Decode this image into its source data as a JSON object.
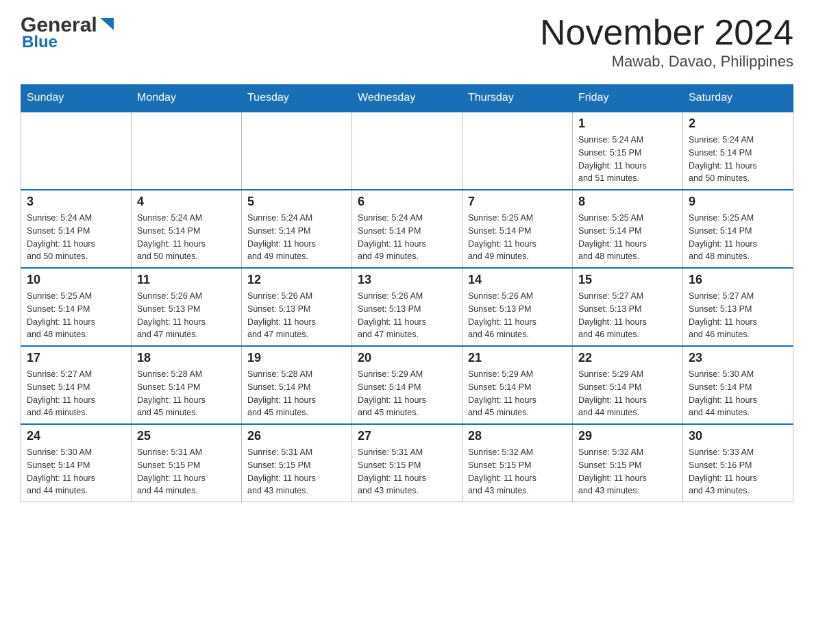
{
  "header": {
    "logo_general": "General",
    "logo_blue": "Blue",
    "month_title": "November 2024",
    "location": "Mawab, Davao, Philippines"
  },
  "days_of_week": [
    "Sunday",
    "Monday",
    "Tuesday",
    "Wednesday",
    "Thursday",
    "Friday",
    "Saturday"
  ],
  "weeks": [
    {
      "days": [
        {
          "number": "",
          "info": ""
        },
        {
          "number": "",
          "info": ""
        },
        {
          "number": "",
          "info": ""
        },
        {
          "number": "",
          "info": ""
        },
        {
          "number": "",
          "info": ""
        },
        {
          "number": "1",
          "info": "Sunrise: 5:24 AM\nSunset: 5:15 PM\nDaylight: 11 hours\nand 51 minutes."
        },
        {
          "number": "2",
          "info": "Sunrise: 5:24 AM\nSunset: 5:14 PM\nDaylight: 11 hours\nand 50 minutes."
        }
      ]
    },
    {
      "days": [
        {
          "number": "3",
          "info": "Sunrise: 5:24 AM\nSunset: 5:14 PM\nDaylight: 11 hours\nand 50 minutes."
        },
        {
          "number": "4",
          "info": "Sunrise: 5:24 AM\nSunset: 5:14 PM\nDaylight: 11 hours\nand 50 minutes."
        },
        {
          "number": "5",
          "info": "Sunrise: 5:24 AM\nSunset: 5:14 PM\nDaylight: 11 hours\nand 49 minutes."
        },
        {
          "number": "6",
          "info": "Sunrise: 5:24 AM\nSunset: 5:14 PM\nDaylight: 11 hours\nand 49 minutes."
        },
        {
          "number": "7",
          "info": "Sunrise: 5:25 AM\nSunset: 5:14 PM\nDaylight: 11 hours\nand 49 minutes."
        },
        {
          "number": "8",
          "info": "Sunrise: 5:25 AM\nSunset: 5:14 PM\nDaylight: 11 hours\nand 48 minutes."
        },
        {
          "number": "9",
          "info": "Sunrise: 5:25 AM\nSunset: 5:14 PM\nDaylight: 11 hours\nand 48 minutes."
        }
      ]
    },
    {
      "days": [
        {
          "number": "10",
          "info": "Sunrise: 5:25 AM\nSunset: 5:14 PM\nDaylight: 11 hours\nand 48 minutes."
        },
        {
          "number": "11",
          "info": "Sunrise: 5:26 AM\nSunset: 5:13 PM\nDaylight: 11 hours\nand 47 minutes."
        },
        {
          "number": "12",
          "info": "Sunrise: 5:26 AM\nSunset: 5:13 PM\nDaylight: 11 hours\nand 47 minutes."
        },
        {
          "number": "13",
          "info": "Sunrise: 5:26 AM\nSunset: 5:13 PM\nDaylight: 11 hours\nand 47 minutes."
        },
        {
          "number": "14",
          "info": "Sunrise: 5:26 AM\nSunset: 5:13 PM\nDaylight: 11 hours\nand 46 minutes."
        },
        {
          "number": "15",
          "info": "Sunrise: 5:27 AM\nSunset: 5:13 PM\nDaylight: 11 hours\nand 46 minutes."
        },
        {
          "number": "16",
          "info": "Sunrise: 5:27 AM\nSunset: 5:13 PM\nDaylight: 11 hours\nand 46 minutes."
        }
      ]
    },
    {
      "days": [
        {
          "number": "17",
          "info": "Sunrise: 5:27 AM\nSunset: 5:14 PM\nDaylight: 11 hours\nand 46 minutes."
        },
        {
          "number": "18",
          "info": "Sunrise: 5:28 AM\nSunset: 5:14 PM\nDaylight: 11 hours\nand 45 minutes."
        },
        {
          "number": "19",
          "info": "Sunrise: 5:28 AM\nSunset: 5:14 PM\nDaylight: 11 hours\nand 45 minutes."
        },
        {
          "number": "20",
          "info": "Sunrise: 5:29 AM\nSunset: 5:14 PM\nDaylight: 11 hours\nand 45 minutes."
        },
        {
          "number": "21",
          "info": "Sunrise: 5:29 AM\nSunset: 5:14 PM\nDaylight: 11 hours\nand 45 minutes."
        },
        {
          "number": "22",
          "info": "Sunrise: 5:29 AM\nSunset: 5:14 PM\nDaylight: 11 hours\nand 44 minutes."
        },
        {
          "number": "23",
          "info": "Sunrise: 5:30 AM\nSunset: 5:14 PM\nDaylight: 11 hours\nand 44 minutes."
        }
      ]
    },
    {
      "days": [
        {
          "number": "24",
          "info": "Sunrise: 5:30 AM\nSunset: 5:14 PM\nDaylight: 11 hours\nand 44 minutes."
        },
        {
          "number": "25",
          "info": "Sunrise: 5:31 AM\nSunset: 5:15 PM\nDaylight: 11 hours\nand 44 minutes."
        },
        {
          "number": "26",
          "info": "Sunrise: 5:31 AM\nSunset: 5:15 PM\nDaylight: 11 hours\nand 43 minutes."
        },
        {
          "number": "27",
          "info": "Sunrise: 5:31 AM\nSunset: 5:15 PM\nDaylight: 11 hours\nand 43 minutes."
        },
        {
          "number": "28",
          "info": "Sunrise: 5:32 AM\nSunset: 5:15 PM\nDaylight: 11 hours\nand 43 minutes."
        },
        {
          "number": "29",
          "info": "Sunrise: 5:32 AM\nSunset: 5:15 PM\nDaylight: 11 hours\nand 43 minutes."
        },
        {
          "number": "30",
          "info": "Sunrise: 5:33 AM\nSunset: 5:16 PM\nDaylight: 11 hours\nand 43 minutes."
        }
      ]
    }
  ]
}
